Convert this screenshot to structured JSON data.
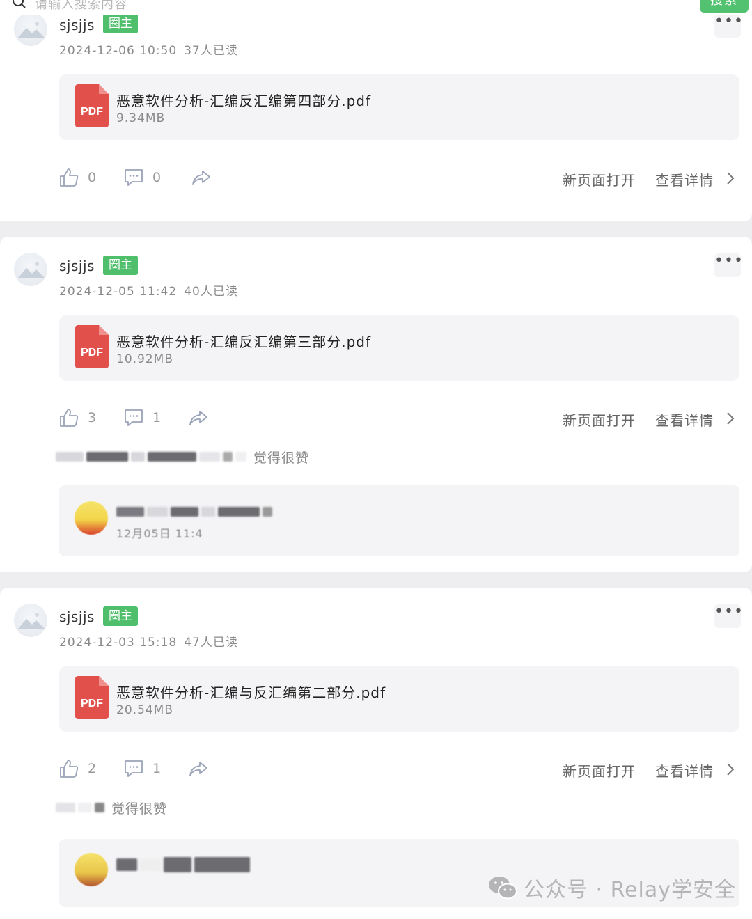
{
  "search": {
    "placeholder": "请输入搜索内容",
    "button_label": "搜索"
  },
  "colors": {
    "accent_green": "#52c270",
    "badge_green": "#4fbf6c",
    "pdf_red": "#e2504c"
  },
  "posts": [
    {
      "author": "sjsjjs",
      "badge": "圈主",
      "date": "2024-12-06 10:50",
      "reads": "37人已读",
      "file": {
        "name": "恶意软件分析-汇编反汇编第四部分.pdf",
        "size": "9.34MB",
        "type_label": "PDF"
      },
      "likes": "0",
      "comments": "0",
      "open_label": "新页面打开",
      "detail_label": "查看详情"
    },
    {
      "author": "sjsjjs",
      "badge": "圈主",
      "date": "2024-12-05 11:42",
      "reads": "40人已读",
      "file": {
        "name": "恶意软件分析-汇编反汇编第三部分.pdf",
        "size": "10.92MB",
        "type_label": "PDF"
      },
      "likes": "3",
      "comments": "1",
      "open_label": "新页面打开",
      "detail_label": "查看详情",
      "liked_text": "觉得很赞",
      "comment_time": "12月05日 11:4"
    },
    {
      "author": "sjsjjs",
      "badge": "圈主",
      "date": "2024-12-03 15:18",
      "reads": "47人已读",
      "file": {
        "name": "恶意软件分析-汇编与反汇编第二部分.pdf",
        "size": "20.54MB",
        "type_label": "PDF"
      },
      "likes": "2",
      "comments": "1",
      "open_label": "新页面打开",
      "detail_label": "查看详情",
      "liked_text": "觉得很赞"
    }
  ],
  "watermark": "公众号 · Relay学安全"
}
